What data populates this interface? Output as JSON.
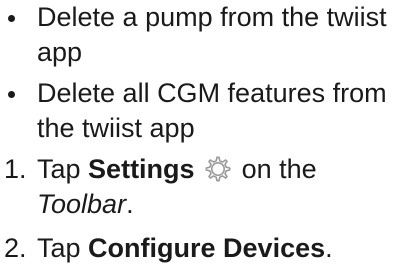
{
  "bullets": [
    {
      "line1": "Delete a pump from the twiist",
      "line2": "app"
    },
    {
      "line1": "Delete all CGM features from",
      "line2": "the twiist app"
    }
  ],
  "steps": [
    {
      "number": "1.",
      "pre": "Tap ",
      "bold": "Settings",
      "icon": "settings-gear-icon",
      "post": " on the",
      "line2_italic": "Toolbar",
      "line2_post": "."
    },
    {
      "number": "2.",
      "pre": "Tap ",
      "bold": "Configure Devices",
      "post": "."
    }
  ]
}
